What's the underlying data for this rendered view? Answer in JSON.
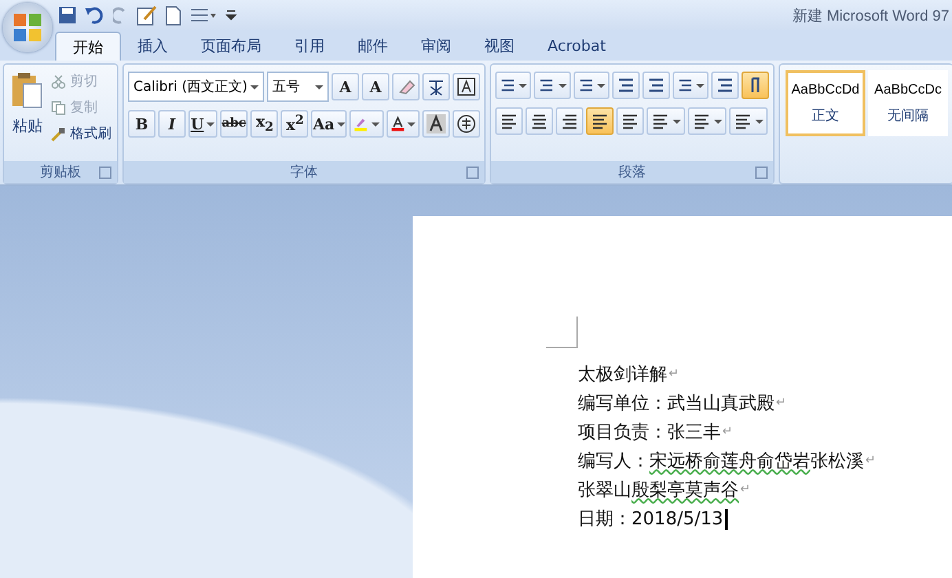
{
  "window": {
    "title": "新建 Microsoft Word 97"
  },
  "tabs": [
    {
      "label": "开始",
      "selected": true
    },
    {
      "label": "插入",
      "selected": false
    },
    {
      "label": "页面布局",
      "selected": false
    },
    {
      "label": "引用",
      "selected": false
    },
    {
      "label": "邮件",
      "selected": false
    },
    {
      "label": "审阅",
      "selected": false
    },
    {
      "label": "视图",
      "selected": false
    },
    {
      "label": "Acrobat",
      "selected": false
    }
  ],
  "clipboard": {
    "title": "剪贴板",
    "paste": "粘贴",
    "items": [
      {
        "label": "剪切",
        "disabled": true
      },
      {
        "label": "复制",
        "disabled": true
      },
      {
        "label": "格式刷",
        "disabled": false
      }
    ]
  },
  "font": {
    "title": "字体",
    "font_name": "Calibri (西文正文)",
    "font_size": "五号",
    "row1": [
      {
        "label": "A"
      },
      {
        "label": "A"
      }
    ],
    "row2": [
      {
        "label": "B",
        "dropdown": false
      },
      {
        "label": "I",
        "dropdown": false
      },
      {
        "label": "U",
        "dropdown": true
      },
      {
        "label": "abc",
        "dropdown": false
      },
      {
        "label": "x$_{2}$",
        "dropdown": false
      },
      {
        "label": "x$^{2}$",
        "dropdown": false
      },
      {
        "label": "Aa",
        "dropdown": true
      }
    ]
  },
  "paragraph": {
    "title": "段落",
    "row1": [
      {
        "selected": false,
        "dropdown": true
      },
      {
        "selected": false,
        "dropdown": true
      },
      {
        "selected": false,
        "dropdown": true
      },
      {
        "selected": false,
        "dropdown": false
      },
      {
        "selected": false,
        "dropdown": false
      },
      {
        "selected": false,
        "dropdown": true
      },
      {
        "selected": false,
        "dropdown": false
      },
      {
        "selected": true,
        "dropdown": false
      }
    ],
    "row2": [
      {
        "selected": false,
        "dropdown": false
      },
      {
        "selected": false,
        "dropdown": false
      },
      {
        "selected": false,
        "dropdown": false
      },
      {
        "selected": true,
        "dropdown": false
      },
      {
        "selected": false,
        "dropdown": false
      },
      {
        "selected": false,
        "dropdown": true
      },
      {
        "selected": false,
        "dropdown": true
      },
      {
        "selected": false,
        "dropdown": true
      }
    ]
  },
  "styles": [
    {
      "sample": "AaBbCcDd",
      "name": "正文",
      "selected": true
    },
    {
      "sample": "AaBbCcDc",
      "name": "无间隔",
      "selected": false
    }
  ],
  "document": {
    "lines": [
      {
        "segments": [
          {
            "text": "太极剑详解",
            "misspelled": false
          }
        ],
        "mark": "↵"
      },
      {
        "segments": [
          {
            "text": "编写单位：武当山真武殿",
            "misspelled": false
          }
        ],
        "mark": "↵"
      },
      {
        "segments": [
          {
            "text": "项目负责：张三丰",
            "misspelled": false
          }
        ],
        "mark": "↵"
      },
      {
        "segments": [
          {
            "text": "编写人：",
            "misspelled": false
          },
          {
            "text": "宋远桥俞莲舟俞岱岩",
            "misspelled": true
          },
          {
            "text": "张松溪",
            "misspelled": false
          }
        ],
        "mark": "↵"
      },
      {
        "segments": [
          {
            "text": "张翠山",
            "misspelled": false
          },
          {
            "text": "殷梨亭莫声谷",
            "misspelled": true
          }
        ],
        "mark": "↵"
      },
      {
        "segments": [
          {
            "text": "日期：2018/5/13",
            "misspelled": false
          }
        ]
      }
    ]
  }
}
